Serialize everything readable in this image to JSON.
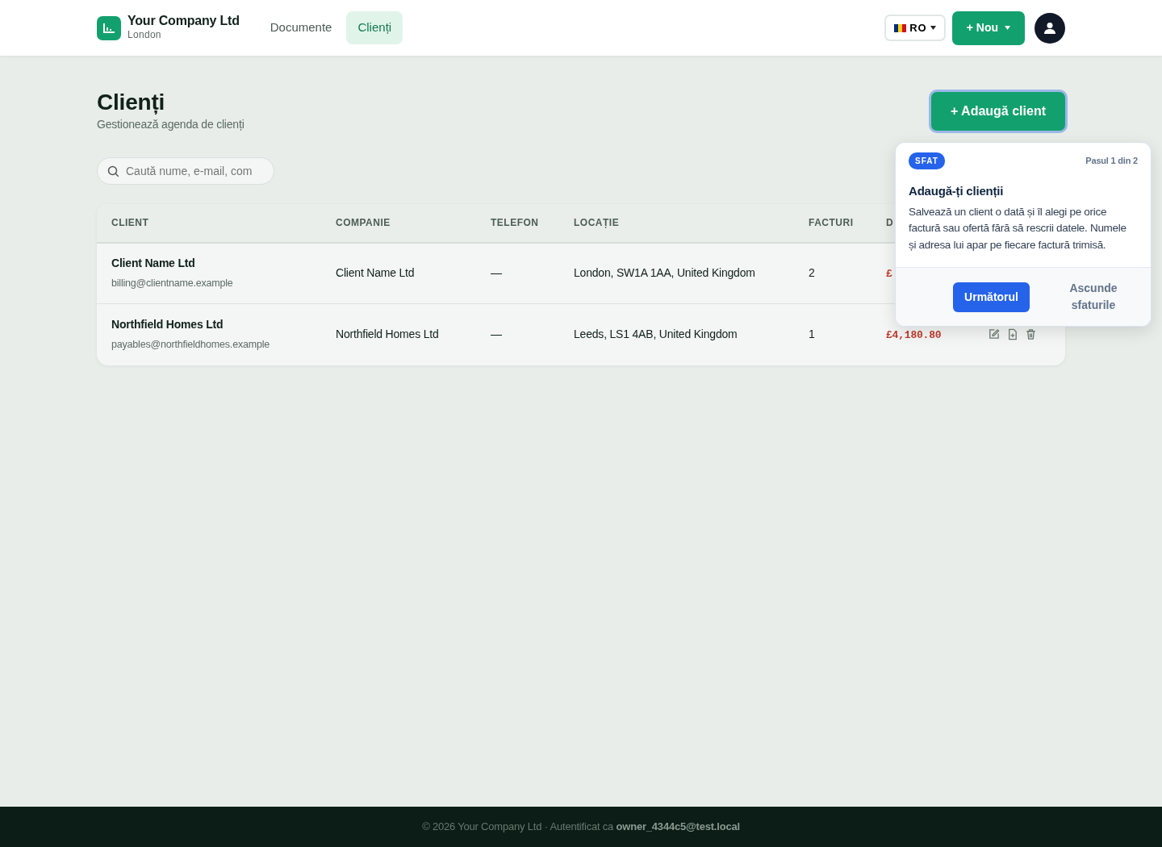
{
  "brand": {
    "name": "Your Company Ltd",
    "city": "London"
  },
  "nav": [
    {
      "label": "Documente",
      "selected": false
    },
    {
      "label": "Clienți",
      "selected": true
    }
  ],
  "lang": {
    "code": "RO"
  },
  "new_button": {
    "label": "+ Nou"
  },
  "page": {
    "title": "Clienți",
    "subtitle": "Gestionează agenda de clienți",
    "add_button": "+ Adaugă client"
  },
  "search": {
    "placeholder": "Caută nume, e-mail, com"
  },
  "table": {
    "columns": [
      "CLIENT",
      "COMPANIE",
      "TELEFON",
      "LOCAȚIE",
      "FACTURI",
      "D"
    ],
    "rows": [
      {
        "name": "Client Name Ltd",
        "email": "billing@clientname.example",
        "company": "Client Name Ltd",
        "phone": "—",
        "location": "London, SW1A 1AA, United Kingdom",
        "invoices": "2",
        "amount": "£"
      },
      {
        "name": "Northfield Homes Ltd",
        "email": "payables@northfieldhomes.example",
        "company": "Northfield Homes Ltd",
        "phone": "—",
        "location": "Leeds, LS1 4AB, United Kingdom",
        "invoices": "1",
        "amount": "£4,180.80"
      }
    ]
  },
  "tip": {
    "badge": "SFAT",
    "step": "Pasul 1 din 2",
    "title": "Adaugă-ți clienții",
    "body": "Salvează un client o dată și îl alegi pe orice factură sau ofertă fără să rescrii datele. Numele și adresa lui apar pe fiecare factură trimisă.",
    "next": "Următorul",
    "hide": "Ascunde sfaturile"
  },
  "footer": {
    "text": "© 2026 Your Company Ltd · Autentificat ca **owner_4344c5@test.local**"
  }
}
